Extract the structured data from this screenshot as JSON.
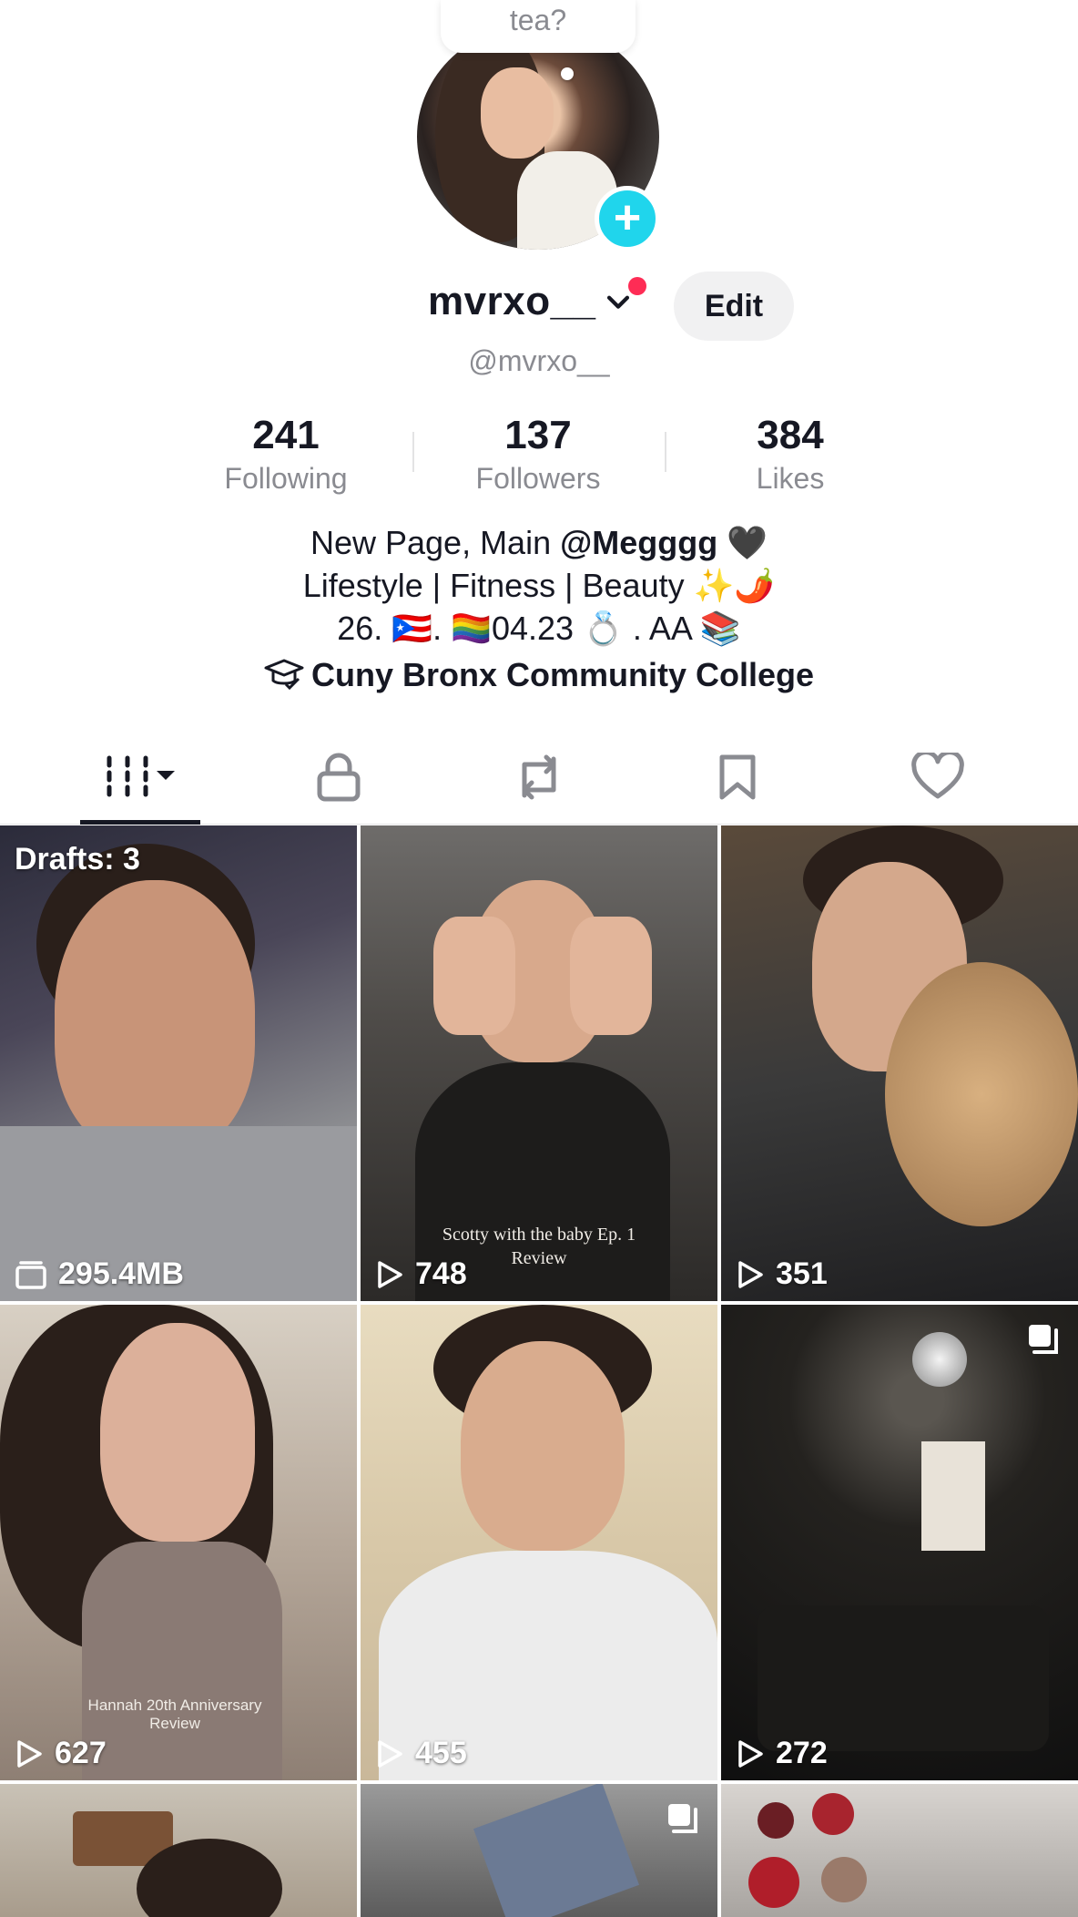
{
  "profile": {
    "bubble_text": "tea?",
    "display_name": "mvrxo__",
    "handle": "@mvrxo__",
    "edit_label": "Edit"
  },
  "stats": [
    {
      "value": "241",
      "label": "Following"
    },
    {
      "value": "137",
      "label": "Followers"
    },
    {
      "value": "384",
      "label": "Likes"
    }
  ],
  "bio": {
    "line1_pre": "New Page, Main ",
    "line1_mention": "@Megggg",
    "line1_post": " 🖤",
    "line2": "Lifestyle | Fitness | Beauty ✨🌶️",
    "line3": "26. 🇵🇷. 🏳️‍🌈04.23 💍 . AA 📚",
    "school": "Cuny Bronx Community College"
  },
  "tabs": [
    {
      "icon": "grid-icon",
      "active": true
    },
    {
      "icon": "lock-icon"
    },
    {
      "icon": "repost-icon"
    },
    {
      "icon": "bookmark-icon"
    },
    {
      "icon": "heart-icon"
    }
  ],
  "videos": [
    {
      "overlay": "295.4MB",
      "badge": "Drafts: 3",
      "type": "drafts"
    },
    {
      "overlay": "748",
      "caption": "Scotty with the baby Ep. 1\nReview",
      "type": "views"
    },
    {
      "overlay": "351",
      "type": "views"
    },
    {
      "overlay": "627",
      "caption": "Hannah 20th Anniversary\nReview",
      "type": "views"
    },
    {
      "overlay": "455",
      "type": "views"
    },
    {
      "overlay": "272",
      "type": "views",
      "multi": true
    },
    {
      "overlay": "",
      "type": "partial"
    },
    {
      "overlay": "",
      "type": "partial",
      "multi": true
    },
    {
      "overlay": "",
      "type": "partial"
    }
  ],
  "colors": {
    "accent_cyan": "#20d5ec",
    "notification_red": "#fe2c55",
    "secondary_text": "#8a8b91",
    "primary_text": "#161823"
  }
}
